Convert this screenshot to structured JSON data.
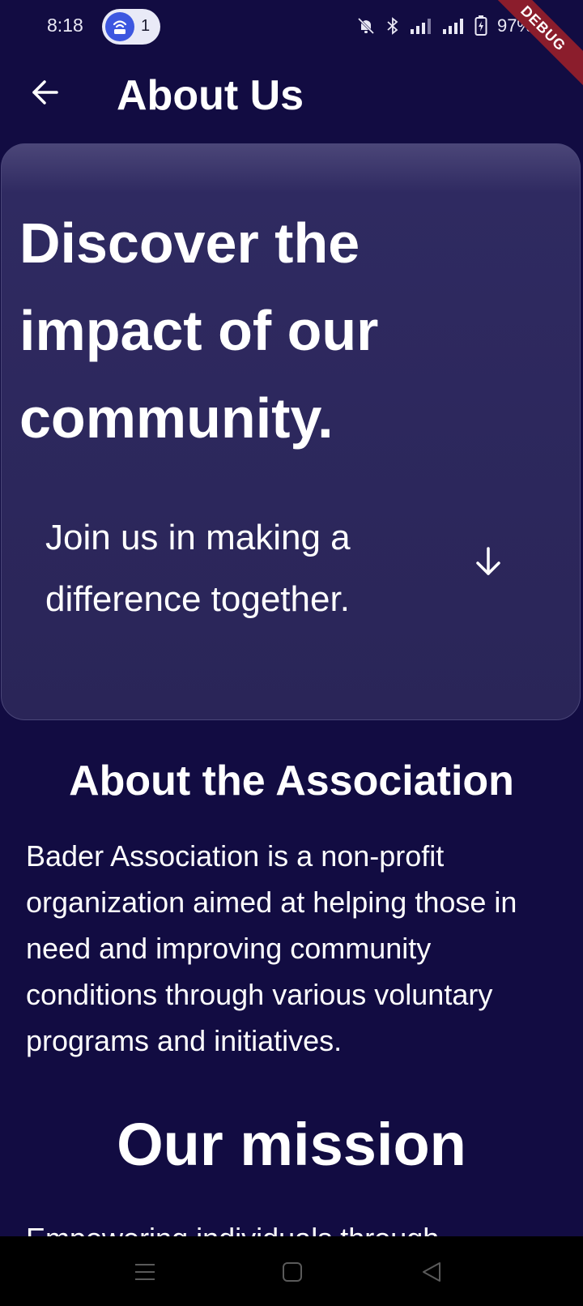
{
  "status_bar": {
    "time": "8:18",
    "hotspot_count": "1",
    "battery": "97%",
    "debug_label": "DEBUG",
    "icons": [
      "hotspot-icon",
      "mute-icon",
      "bluetooth-icon",
      "signal-icon",
      "signal-icon",
      "battery-icon"
    ]
  },
  "app_bar": {
    "title": "About Us",
    "back_icon": "arrow-left-icon"
  },
  "hero": {
    "title": "Discover the impact of our community.",
    "subtitle": "Join us in making a difference together.",
    "scroll_icon": "arrow-down-icon"
  },
  "about": {
    "heading": "About the Association",
    "body": "Bader Association is a non-profit organization aimed at helping those in need and improving community conditions through various voluntary programs and initiatives."
  },
  "mission": {
    "heading": "Our mission",
    "body": "Empowering individuals through"
  },
  "nav_bar": {
    "icons": [
      "menu-icon",
      "home-icon",
      "back-icon"
    ]
  },
  "colors": {
    "background": "#120c42",
    "card": "#2a2558",
    "debug_ribbon": "#8b1d2c",
    "hotspot": "#3d57e0"
  }
}
